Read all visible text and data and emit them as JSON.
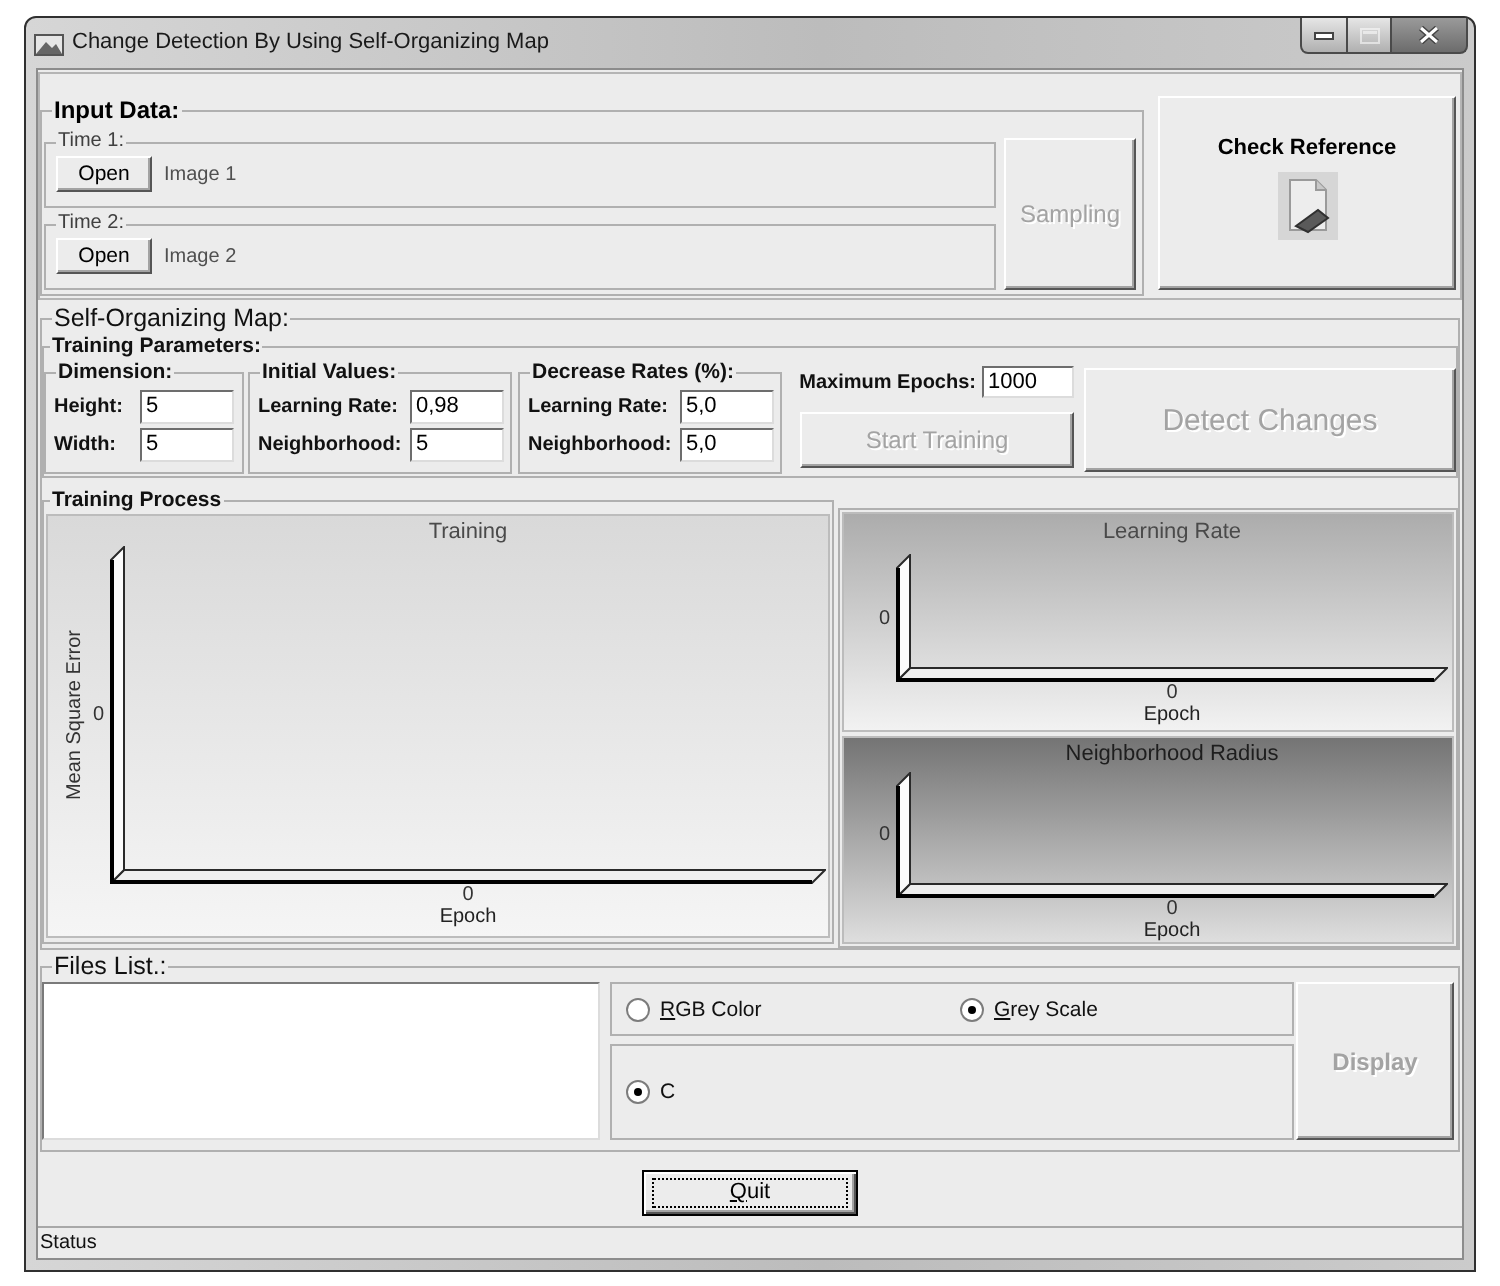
{
  "window": {
    "title": "Change Detection By Using Self-Organizing Map",
    "maximize_disabled": true
  },
  "input_data": {
    "title": "Input Data:",
    "times": [
      {
        "title": "Time 1:",
        "open_button": {
          "label": "Open",
          "disabled": false
        },
        "file_label": "Image 1"
      },
      {
        "title": "Time 2:",
        "open_button": {
          "label": "Open",
          "disabled": false
        },
        "file_label": "Image 2"
      }
    ],
    "sampling_button": {
      "label": "Sampling",
      "disabled": true
    }
  },
  "check_reference_button": {
    "label": "Check Reference",
    "disabled": false
  },
  "self_organizing_map": {
    "title": "Self-Organizing Map:",
    "training_parameters": {
      "title": "Training Parameters:",
      "groups": [
        {
          "title": "Dimension:",
          "fields": [
            {
              "label": "Height:",
              "value": "5"
            },
            {
              "label": "Width:",
              "value": "5"
            }
          ]
        },
        {
          "title": "Initial Values:",
          "fields": [
            {
              "label": "Learning Rate:",
              "value": "0,98"
            },
            {
              "label": "Neighborhood:",
              "value": "5"
            }
          ]
        },
        {
          "title": "Decrease Rates (%):",
          "fields": [
            {
              "label": "Learning Rate:",
              "value": "5,0"
            },
            {
              "label": "Neighborhood:",
              "value": "5,0"
            }
          ]
        }
      ],
      "maximum_epochs": {
        "label": "Maximum Epochs:",
        "value": "1000"
      },
      "start_training_button": {
        "label": "Start Training",
        "disabled": true
      },
      "detect_changes_button": {
        "label": "Detect Changes",
        "disabled": true
      }
    },
    "training_process": {
      "title": "Training Process",
      "chart": {
        "title": "Training",
        "y_axis_title": "Mean Square Error",
        "y_tick": "0",
        "x_tick": "0",
        "x_axis_title": "Epoch"
      }
    },
    "side_charts": [
      {
        "title": "Learning Rate",
        "y_tick": "0",
        "x_tick": "0",
        "x_axis_title": "Epoch"
      },
      {
        "title": "Neighborhood Radius",
        "y_tick": "0",
        "x_tick": "0",
        "x_axis_title": "Epoch"
      }
    ]
  },
  "files_list": {
    "title": "Files List.:",
    "color_modes": [
      {
        "label": "RGB Color",
        "selected": false,
        "access_key_underlined": true
      },
      {
        "label": "Grey Scale",
        "selected": true,
        "access_key_underlined": true
      }
    ],
    "channels": [
      {
        "label": "C",
        "selected": true
      }
    ],
    "display_button": {
      "label": "Display",
      "disabled": true
    }
  },
  "quit_button": {
    "label": "Quit",
    "disabled": false,
    "focused": true,
    "access_key_underlined": true
  },
  "status_bar": {
    "text": "Status"
  }
}
